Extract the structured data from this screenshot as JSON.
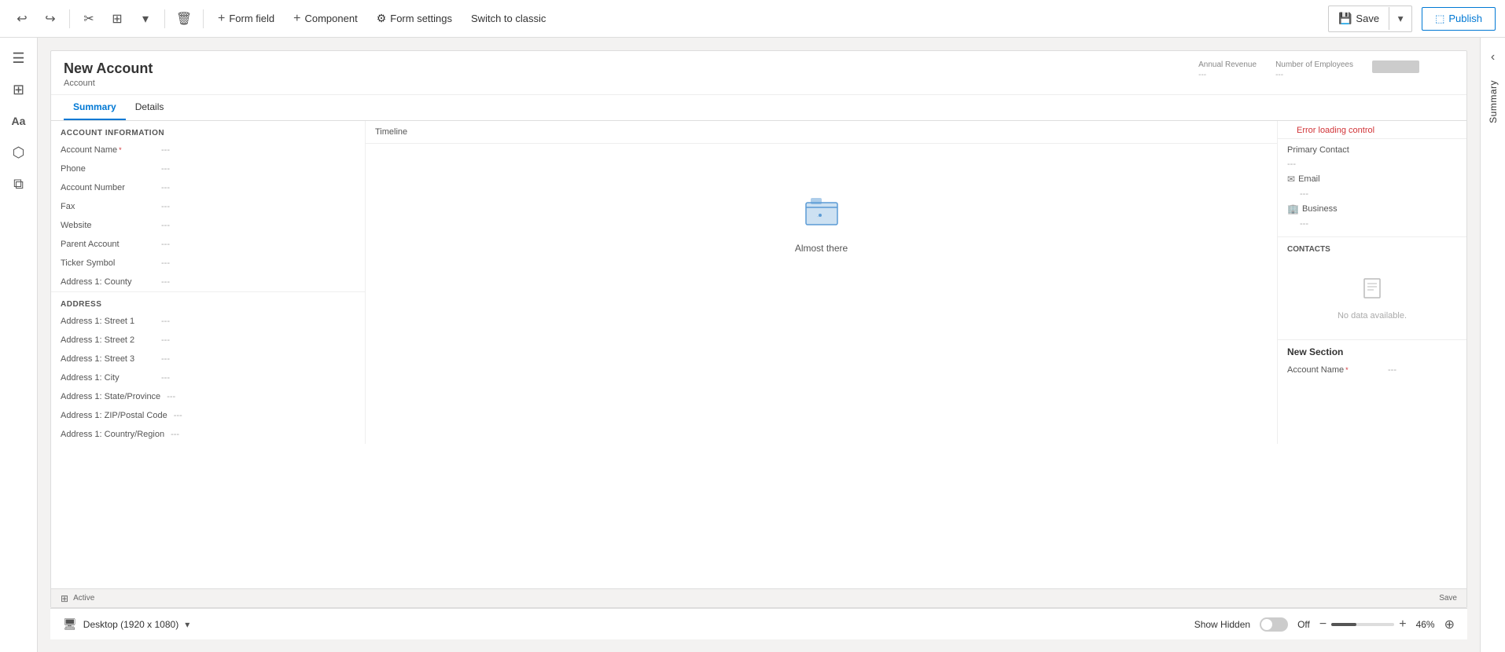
{
  "toolbar": {
    "undo_label": "↩",
    "redo_label": "↪",
    "cut_label": "✂",
    "copy_label": "⧉",
    "dropdown_label": "▾",
    "delete_label": "🗑",
    "form_field_label": "Form field",
    "component_label": "Component",
    "form_settings_label": "Form settings",
    "switch_classic_label": "Switch to classic",
    "save_label": "Save",
    "publish_label": "Publish"
  },
  "left_sidebar": {
    "icons": [
      "☰",
      "⊞",
      "Aa",
      "⬡",
      "⧉"
    ]
  },
  "form": {
    "title": "New Account",
    "subtitle": "Account",
    "header_fields": [
      {
        "label": "Annual Revenue",
        "value": "---"
      },
      {
        "label": "Number of Employees",
        "value": "---"
      }
    ],
    "tabs": [
      {
        "label": "Summary",
        "active": true
      },
      {
        "label": "Details",
        "active": false
      }
    ],
    "account_info_section": {
      "header": "ACCOUNT INFORMATION",
      "fields": [
        {
          "label": "Account Name",
          "required": true,
          "value": "---"
        },
        {
          "label": "Phone",
          "required": false,
          "value": "---"
        },
        {
          "label": "Account Number",
          "required": false,
          "value": "---"
        },
        {
          "label": "Fax",
          "required": false,
          "value": "---"
        },
        {
          "label": "Website",
          "required": false,
          "value": "---"
        },
        {
          "label": "Parent Account",
          "required": false,
          "value": "---"
        },
        {
          "label": "Ticker Symbol",
          "required": false,
          "value": "---"
        },
        {
          "label": "Address 1: County",
          "required": false,
          "value": "---"
        }
      ]
    },
    "address_section": {
      "header": "ADDRESS",
      "fields": [
        {
          "label": "Address 1: Street 1",
          "value": "---"
        },
        {
          "label": "Address 1: Street 2",
          "value": "---"
        },
        {
          "label": "Address 1: Street 3",
          "value": "---"
        },
        {
          "label": "Address 1: City",
          "value": "---"
        },
        {
          "label": "Address 1: State/Province",
          "value": "---"
        },
        {
          "label": "Address 1: ZIP/Postal Code",
          "value": "---"
        },
        {
          "label": "Address 1: Country/Region",
          "value": "---"
        }
      ]
    },
    "timeline": {
      "header": "Timeline",
      "almost_there": "Almost there"
    },
    "contact_info": {
      "primary_contact_label": "Primary Contact",
      "primary_contact_value": "---",
      "email_label": "Email",
      "email_value": "---",
      "business_label": "Business",
      "business_value": "---"
    },
    "contacts_section": {
      "header": "CONTACTS",
      "no_data": "No data available."
    },
    "error_loading": "Error loading control",
    "new_section": {
      "header": "New Section",
      "fields": [
        {
          "label": "Account Name",
          "required": true,
          "value": "---"
        }
      ]
    }
  },
  "bottom_bar": {
    "preview_status": "Active",
    "show_hidden_label": "Show Hidden",
    "toggle_state": "Off",
    "zoom_percent": "46%",
    "device_label": "Desktop (1920 x 1080)"
  },
  "right_sidebar": {
    "summary_label": "Summary"
  }
}
